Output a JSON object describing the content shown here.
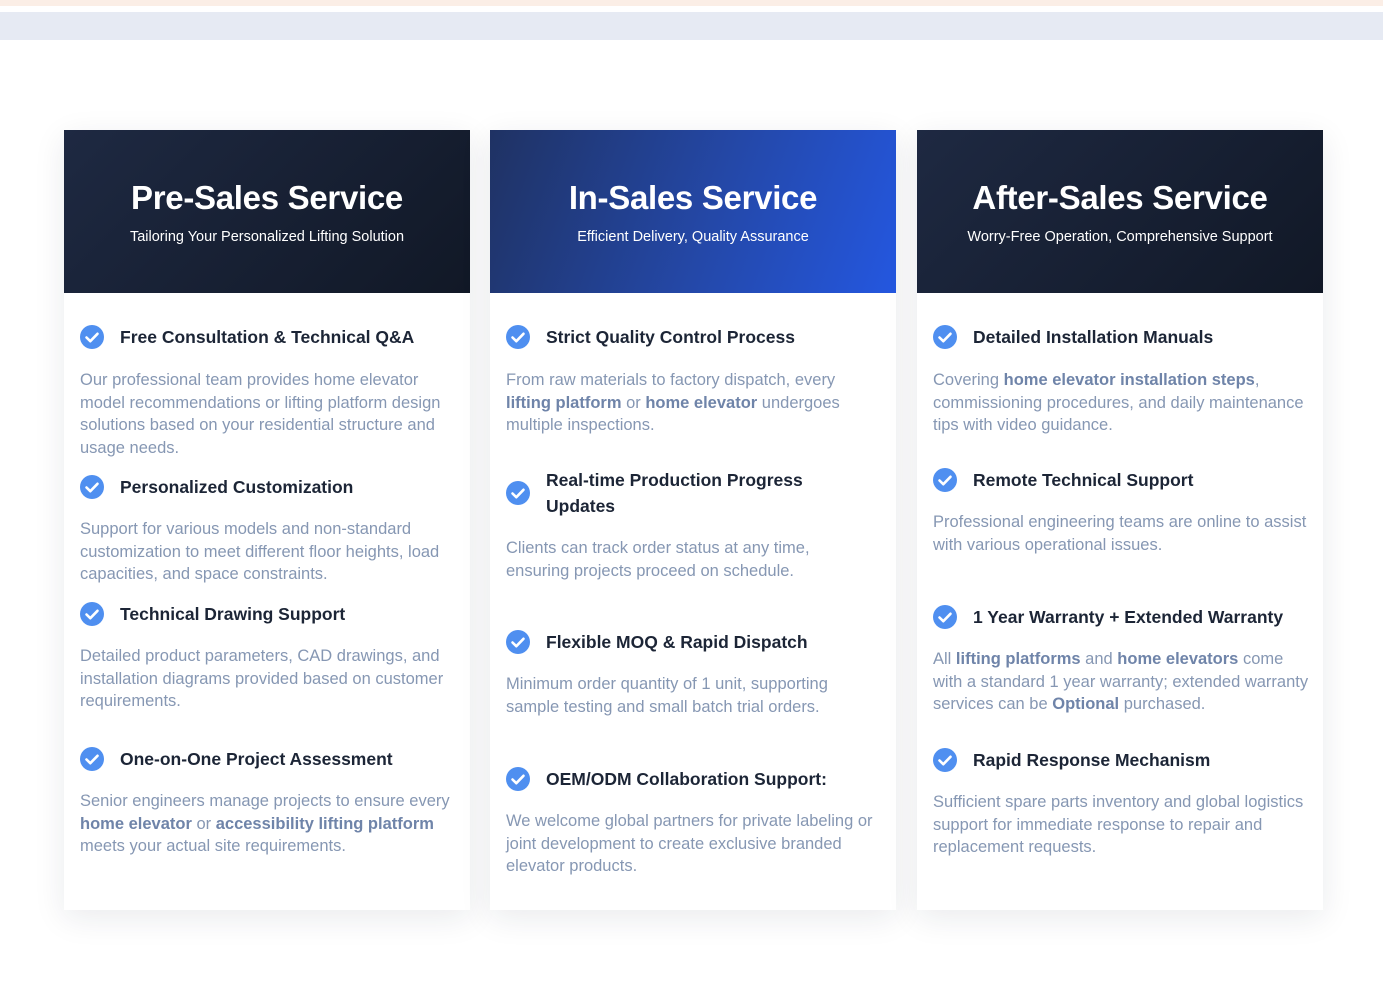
{
  "cards": [
    {
      "title": "Pre-Sales Service",
      "subtitle": "Tailoring Your Personalized Lifting Solution",
      "items": [
        {
          "title": "Free Consultation & Technical Q&A",
          "desc": [
            {
              "t": "Our professional team provides home elevator model recommendations or lifting platform design solutions based on your residential structure and usage needs."
            }
          ]
        },
        {
          "title": "Personalized Customization",
          "desc": [
            {
              "t": "Support for various models and non-standard customization to meet different floor heights, load capacities, and space constraints."
            }
          ]
        },
        {
          "title": "Technical Drawing Support",
          "desc": [
            {
              "t": "Detailed product parameters, CAD drawings, and installation diagrams provided based on customer requirements."
            }
          ]
        },
        {
          "title": "One-on-One Project Assessment",
          "desc": [
            {
              "t": "Senior engineers manage projects to ensure every "
            },
            {
              "t": "home elevator",
              "hl": true
            },
            {
              "t": " or "
            },
            {
              "t": "accessibility lifting platform",
              "hl": true
            },
            {
              "t": " meets your actual site requirements."
            }
          ]
        }
      ]
    },
    {
      "title": "In-Sales Service",
      "subtitle": "Efficient Delivery, Quality Assurance",
      "items": [
        {
          "title": "Strict Quality Control Process",
          "desc": [
            {
              "t": "From raw materials to factory dispatch, every "
            },
            {
              "t": "lifting platform",
              "hl": true
            },
            {
              "t": " or "
            },
            {
              "t": "home elevator",
              "hl": true
            },
            {
              "t": " undergoes multiple inspections."
            }
          ]
        },
        {
          "title": "Real-time Production Progress Updates",
          "desc": [
            {
              "t": "Clients can track order status at any time, ensuring projects proceed on schedule."
            }
          ]
        },
        {
          "title": "Flexible MOQ & Rapid Dispatch",
          "desc": [
            {
              "t": "Minimum order quantity of 1 unit, supporting sample testing and small batch trial orders."
            }
          ]
        },
        {
          "title": "OEM/ODM Collaboration Support:",
          "desc": [
            {
              "t": "We welcome global partners for private labeling or joint development to create exclusive branded elevator products."
            }
          ]
        }
      ]
    },
    {
      "title": "After-Sales Service",
      "subtitle": "Worry-Free Operation, Comprehensive Support",
      "items": [
        {
          "title": "Detailed Installation Manuals",
          "desc": [
            {
              "t": "Covering "
            },
            {
              "t": "home elevator installation steps",
              "hl": true
            },
            {
              "t": ", commissioning procedures, and daily maintenance tips with video guidance."
            }
          ]
        },
        {
          "title": "Remote Technical Support",
          "desc": [
            {
              "t": "Professional engineering teams are online to assist with various operational issues."
            }
          ]
        },
        {
          "title": "1 Year Warranty + Extended Warranty",
          "desc": [
            {
              "t": "All "
            },
            {
              "t": "lifting platforms",
              "hl": true
            },
            {
              "t": " and "
            },
            {
              "t": "home elevators",
              "hl": true
            },
            {
              "t": " come with a standard 1 year warranty; extended warranty services can be "
            },
            {
              "t": "Optional",
              "hl": true
            },
            {
              "t": " purchased."
            }
          ]
        },
        {
          "title": "Rapid Response Mechanism",
          "desc": [
            {
              "t": "Sufficient spare parts inventory and global logistics support for immediate response to repair and replacement requests."
            }
          ]
        }
      ]
    }
  ],
  "colors": {
    "accent": "#4f8ff0",
    "title_text": "#1c2536",
    "desc_text": "#8697b3",
    "highlight_text": "#6f84a9",
    "header_dark": "#151d2e",
    "header_blue": "#2457e0"
  }
}
